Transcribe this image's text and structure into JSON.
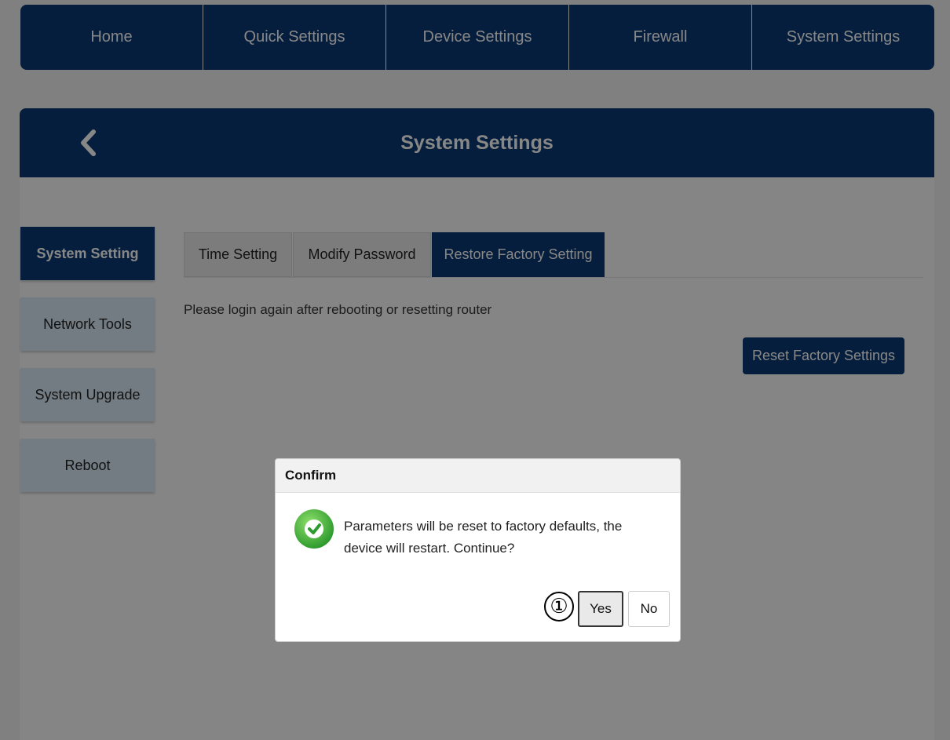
{
  "topnav": {
    "items": [
      {
        "label": "Home"
      },
      {
        "label": "Quick Settings"
      },
      {
        "label": "Device Settings"
      },
      {
        "label": "Firewall"
      },
      {
        "label": "System Settings"
      }
    ]
  },
  "header": {
    "back_icon": "chevron-left-icon",
    "title": "System Settings"
  },
  "sidebar": {
    "items": [
      {
        "label": "System Setting",
        "active": true
      },
      {
        "label": "Network Tools",
        "active": false
      },
      {
        "label": "System Upgrade",
        "active": false
      },
      {
        "label": "Reboot",
        "active": false
      }
    ]
  },
  "tabs": {
    "items": [
      {
        "label": "Time Setting",
        "active": false
      },
      {
        "label": "Modify Password",
        "active": false
      },
      {
        "label": "Restore Factory Setting",
        "active": true
      }
    ]
  },
  "main": {
    "notice": "Please login again after rebooting or resetting router",
    "reset_button": "Reset Factory Settings"
  },
  "dialog": {
    "title": "Confirm",
    "icon": "check-circle-icon",
    "message_line1": "Parameters will be reset to factory defaults, the",
    "message_line2": "device will restart. Continue?",
    "yes_label": "Yes",
    "no_label": "No",
    "step_marker": "①"
  },
  "colors": {
    "primary": "#0b3a73",
    "sidebar_inactive": "#d9eaf6",
    "success_green": "#4cb24a"
  }
}
